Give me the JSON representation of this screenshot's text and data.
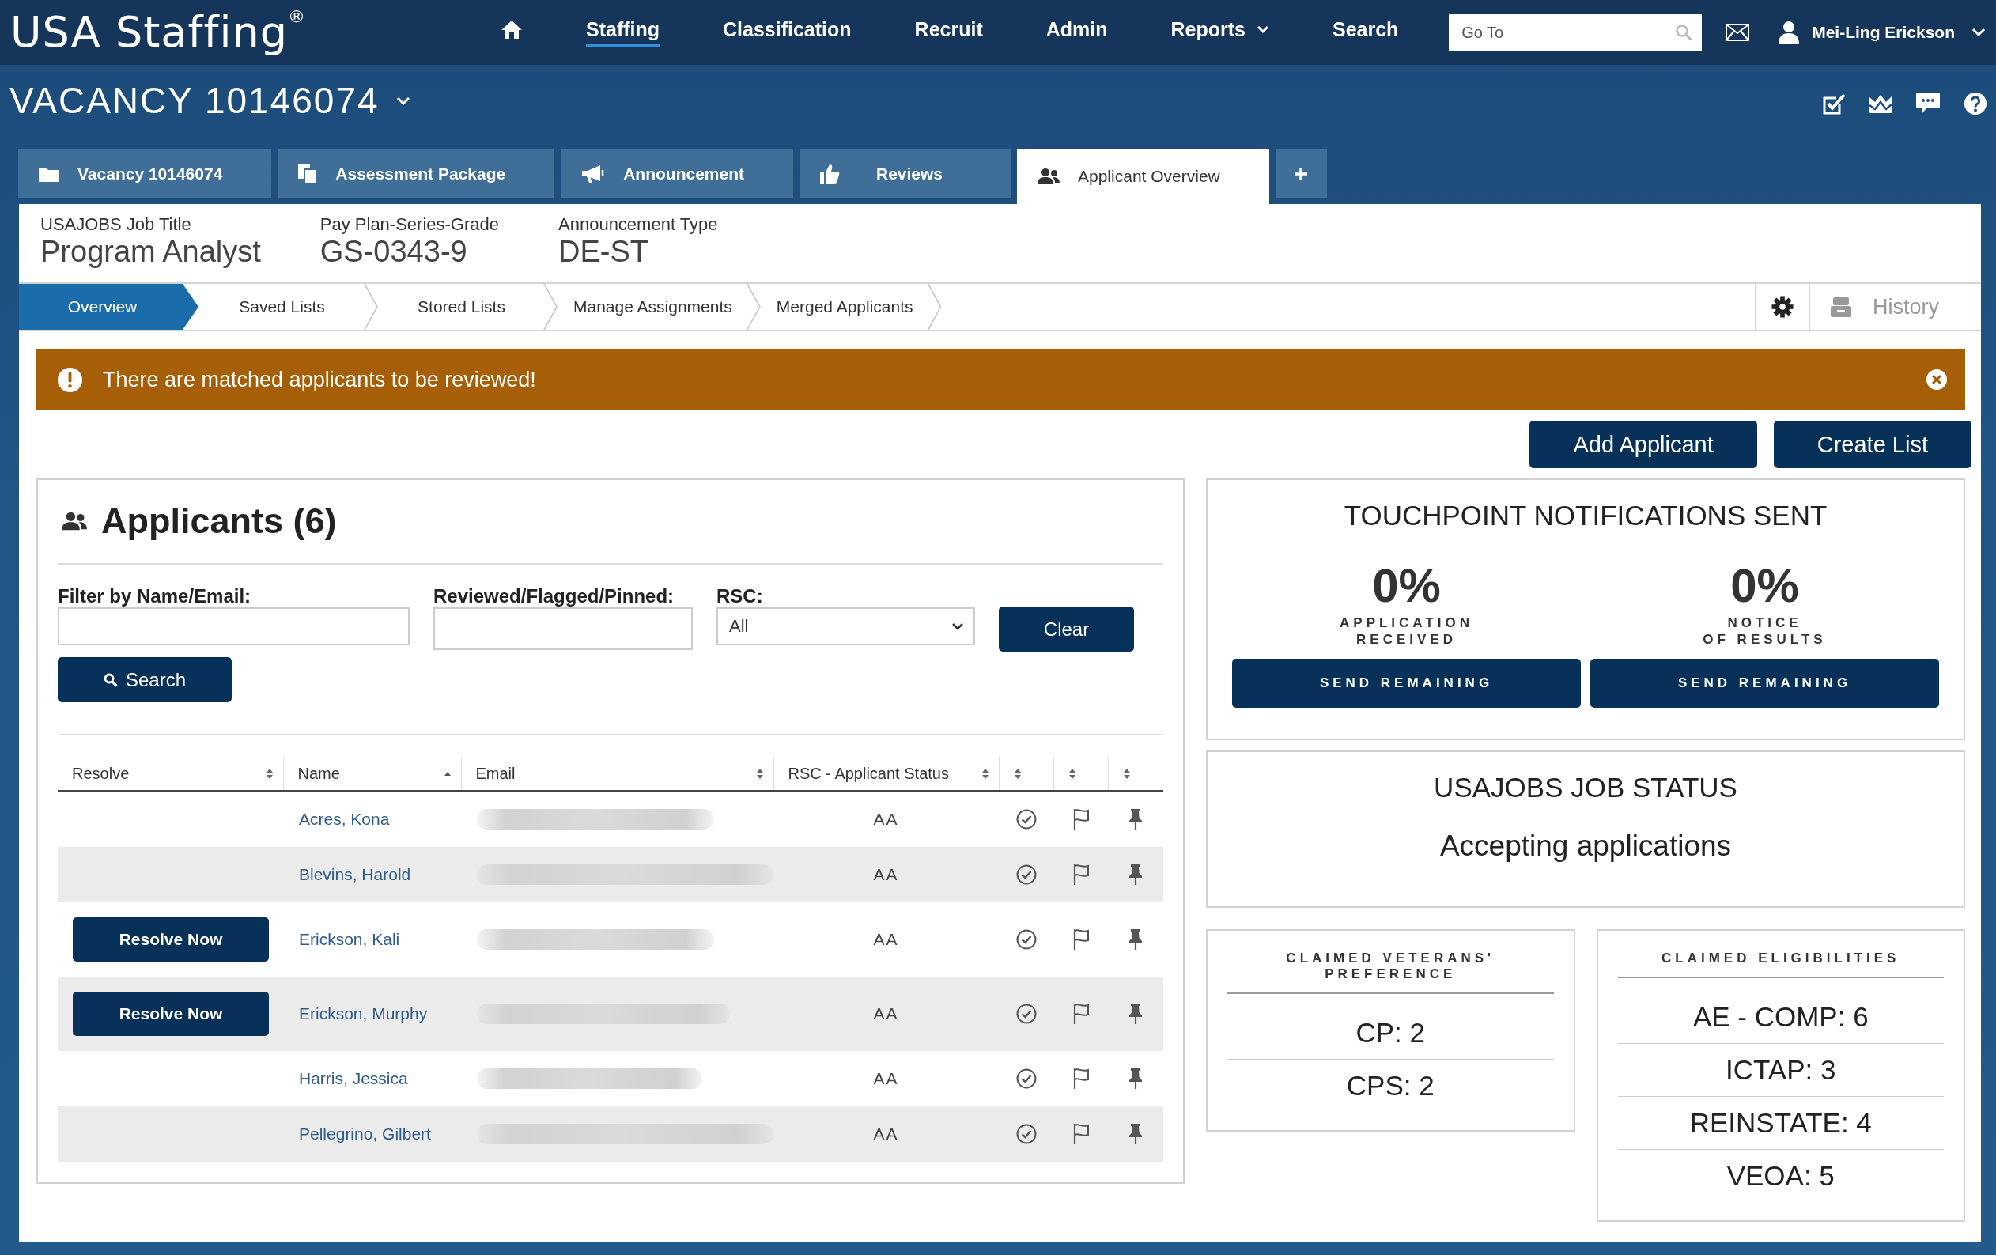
{
  "header": {
    "logo": "USA Staffing$^{®}$",
    "nav": [
      {
        "kind": "home",
        "selected": false
      },
      {
        "kind": "link",
        "label": "Staffing",
        "selected": true
      },
      {
        "kind": "link",
        "label": "Classification",
        "selected": false
      },
      {
        "kind": "link",
        "label": "Recruit",
        "selected": false
      },
      {
        "kind": "link",
        "label": "Admin",
        "selected": false
      },
      {
        "kind": "dropdown",
        "label": "Reports",
        "selected": false
      },
      {
        "kind": "link",
        "label": "Search",
        "selected": false
      }
    ],
    "goto": {
      "placeholder": "Go To"
    },
    "user": "Mei-Ling Erickson"
  },
  "vacancy": {
    "title": "VACANCY 10146074"
  },
  "tabs": [
    {
      "kind": "vacancy",
      "label": "Vacancy 10146074",
      "selected": false
    },
    {
      "kind": "assessment",
      "label": "Assessment Package",
      "selected": false
    },
    {
      "kind": "announcement",
      "label": "Announcement",
      "selected": false
    },
    {
      "kind": "reviews",
      "label": "Reviews",
      "selected": false
    },
    {
      "kind": "applicants",
      "label": "Applicant Overview",
      "selected": true
    },
    {
      "kind": "add",
      "selected": false
    }
  ],
  "job": [
    {
      "label": "USAJOBS Job Title",
      "value": "Program Analyst"
    },
    {
      "label": "Pay Plan-Series-Grade",
      "value": "GS-0343-9"
    },
    {
      "label": "Announcement Type",
      "value": "DE-ST"
    }
  ],
  "subnav": {
    "items": [
      {
        "label": "Overview",
        "selected": true
      },
      {
        "label": "Saved Lists",
        "selected": false
      },
      {
        "label": "Stored Lists",
        "selected": false
      },
      {
        "label": "Manage Assignments",
        "selected": false
      },
      {
        "label": "Merged Applicants",
        "selected": false
      }
    ],
    "history": "History"
  },
  "alert": {
    "message": "There are matched applicants to be reviewed!"
  },
  "actions": [
    "Add Applicant",
    "Create List"
  ],
  "applicants": {
    "title": "Applicants (6)",
    "filters": [
      {
        "kind": "text",
        "label": "Filter by Name/Email:"
      },
      {
        "kind": "text",
        "label": "Reviewed/Flagged/Pinned:"
      },
      {
        "kind": "select",
        "label": "RSC:",
        "value": "All"
      }
    ],
    "clear": "Clear",
    "search": "Search",
    "columns": [
      {
        "label": "Resolve",
        "sorted": false
      },
      {
        "label": "Name",
        "sorted": true
      },
      {
        "label": "Email",
        "sorted": false
      },
      {
        "label": "RSC - Applicant Status",
        "sorted": false
      },
      {
        "sorted": false
      },
      {
        "sorted": false
      },
      {
        "sorted": false
      }
    ],
    "rows": [
      {
        "name": "Acres, Kona",
        "status": "AA",
        "reviewed": false,
        "flagged": false,
        "pinned": false
      },
      {
        "name": "Blevins, Harold",
        "status": "AA",
        "reviewed": false,
        "flagged": false,
        "pinned": false
      },
      {
        "resolve": "Resolve Now",
        "name": "Erickson, Kali",
        "status": "AA",
        "reviewed": false,
        "flagged": false,
        "pinned": false
      },
      {
        "resolve": "Resolve Now",
        "name": "Erickson, Murphy",
        "status": "AA",
        "reviewed": false,
        "flagged": false,
        "pinned": false
      },
      {
        "name": "Harris, Jessica",
        "status": "AA",
        "reviewed": false,
        "flagged": false,
        "pinned": false
      },
      {
        "name": "Pellegrino, Gilbert",
        "status": "AA",
        "reviewed": false,
        "flagged": false,
        "pinned": false
      }
    ]
  },
  "touchpoint": {
    "title": "TOUCHPOINT NOTIFICATIONS SENT",
    "items": [
      {
        "percent": "0%",
        "label": "APPLICATION\nRECEIVED",
        "button": "SEND REMAINING"
      },
      {
        "percent": "0%",
        "label": "NOTICE\nOF RESULTS",
        "button": "SEND REMAINING"
      }
    ]
  },
  "job_status": {
    "title": "USAJOBS JOB STATUS",
    "value": "Accepting applications"
  },
  "veterans": {
    "title": "CLAIMED VETERANS'\nPREFERENCE",
    "items": [
      "CP: 2",
      "CPS: 2"
    ]
  },
  "eligibilities": {
    "title": "CLAIMED ELIGIBILITIES",
    "items": [
      "AE - COMP: 6",
      "ICTAP: 3",
      "REINSTATE: 4",
      "VEOA: 5"
    ]
  }
}
